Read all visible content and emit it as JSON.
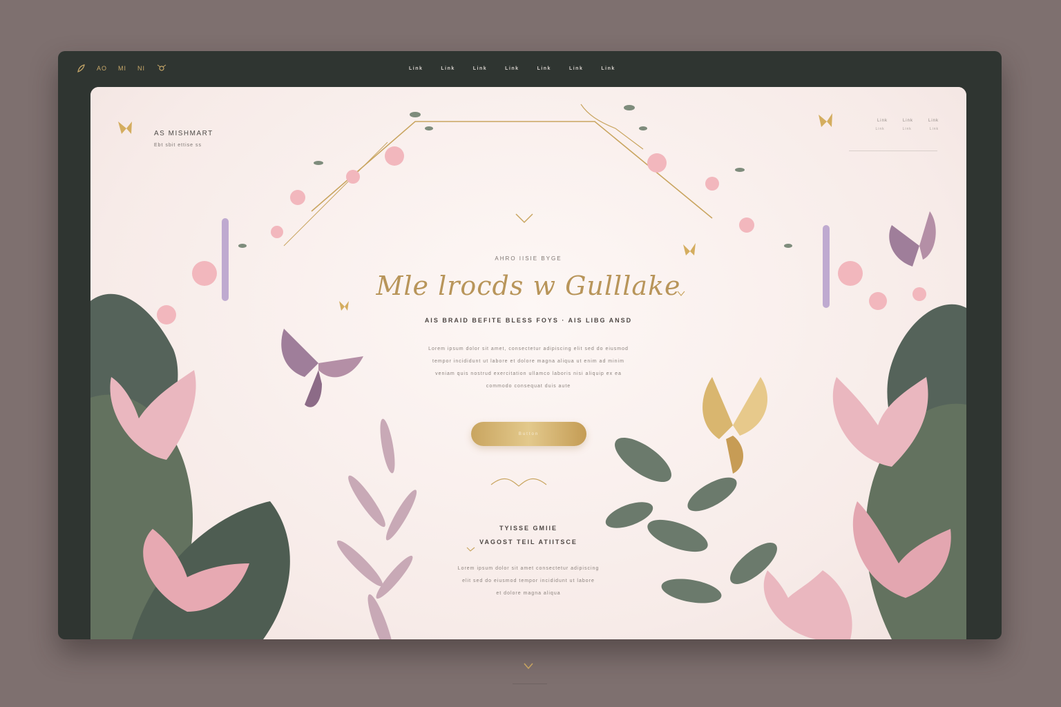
{
  "topbar": {
    "items": [
      "AO",
      "MI",
      "NI"
    ]
  },
  "nav": {
    "items": [
      "Link",
      "Link",
      "Link",
      "Link",
      "Link",
      "Link",
      "Link"
    ]
  },
  "brand": {
    "name": "AS MISHMART",
    "tagline": "Ebt sbit ettise ss"
  },
  "top_right": {
    "links": [
      "Link",
      "Link",
      "Link"
    ],
    "sublinks": [
      "Link",
      "Link",
      "Link"
    ]
  },
  "hero": {
    "eyebrow": "AHRO IISIE BYGE",
    "title": "Mle lrocds w Gulllake",
    "tagline": "AIS BRAID BEFITE BLESS FOYS · AIS LIBG ANSD",
    "body": [
      "Lorem ipsum dolor sit amet, consectetur adipiscing elit sed do eiusmod",
      "tempor incididunt ut labore et dolore magna aliqua ut enim ad minim",
      "veniam quis nostrud exercitation ullamco laboris nisi aliquip ex ea",
      "commodo consequat duis aute"
    ],
    "cta_label": "Button"
  },
  "section": {
    "title_line1": "TYISSE GMIIE",
    "title_line2": "VAGOST TEIL ATIITSCE",
    "body": [
      "Lorem ipsum dolor sit amet consectetur adipiscing",
      "elit sed do eiusmod tempor incididunt ut labore",
      "et dolore magna aliqua"
    ]
  },
  "colors": {
    "frame": "#2f3531",
    "panel": "#fbf4f2",
    "gold": "#c9a560",
    "leaf": "#5f6f61",
    "blush": "#f0c4c4",
    "lavender": "#b8a6c8"
  }
}
